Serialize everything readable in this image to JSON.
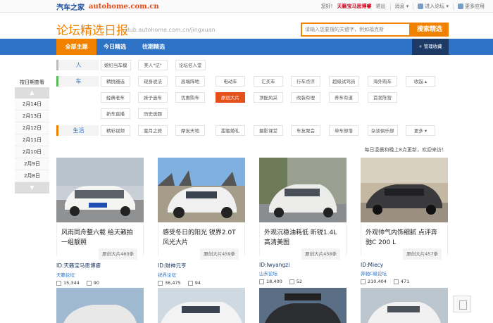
{
  "topbar": {
    "logo_cn": "汽车之家",
    "logo_en": "autohome.com.cn",
    "greeting": "您好!",
    "user": "天籁宝马思博睿",
    "logout": "退出",
    "messages": "消息",
    "enter_forum": "进入论坛",
    "more_apps": "更多应用"
  },
  "header": {
    "title": "论坛精选日报",
    "url": "club.autohome.com.cn/jingxuan",
    "search_placeholder": "请输入您要搜的关键字，例如福克斯",
    "search_button": "搜索精选"
  },
  "nav": {
    "items": [
      "全部主题",
      "今日精选",
      "往期精选"
    ],
    "manage": "+ 管理收藏"
  },
  "categories": {
    "people": {
      "label": "人",
      "tags": [
        "媳妇当车模",
        "美人\"记\"",
        "论坛名人堂"
      ]
    },
    "car": {
      "label": "车",
      "tags": [
        "精挑细选",
        "现身说法",
        "高端阵地",
        "电动车",
        "汇买车",
        "行车点评",
        "超级试驾员",
        "海外购车",
        "收起",
        "经典老车",
        "妹子选车",
        "优惠购车",
        "原创大片",
        "顶配风采",
        "改装有理",
        "养车有道",
        "首发陈营",
        "新车直播",
        "历史选题"
      ]
    },
    "life": {
      "label": "生活",
      "tags": [
        "精彩视频",
        "蜜月之旅",
        "摩友天地",
        "甜蜜婚礼",
        "摄影课堂",
        "车友聚会",
        "单车部落",
        "杂谈俱乐部",
        "更多"
      ]
    }
  },
  "dates": {
    "title": "按日期查看",
    "items": [
      "2月14日",
      "2月13日",
      "2月12日",
      "2月11日",
      "2月10日",
      "2月9日",
      "2月8日"
    ]
  },
  "notice": "每日凌晨和晚上8点更新，欢迎来访！",
  "cards": [
    {
      "caption": "风雨同舟整六载 给天籁拍一组靓照",
      "source": "原创大片460季",
      "id": "ID:天籁宝马思博睿",
      "forum": "天籁论坛",
      "views": "15,344",
      "replies": "90"
    },
    {
      "caption": "感受冬日的阳光 锐界2.0T风光大片",
      "source": "原创大片459季",
      "id": "ID:财神元亨",
      "forum": "锐界论坛",
      "views": "36,475",
      "replies": "94"
    },
    {
      "caption": "外观沉稳油耗低 昕锐1.4L高清美图",
      "source": "原创大片458季",
      "id": "ID:lwyangzi",
      "forum": "山东论坛",
      "views": "18,400",
      "replies": "52"
    },
    {
      "caption": "外观帅气内饰细腻 点评奔驰C 200 L",
      "source": "原创大片457季",
      "id": "ID:Miecy",
      "forum": "奔驰C级论坛",
      "views": "210,404",
      "replies": "471"
    }
  ]
}
